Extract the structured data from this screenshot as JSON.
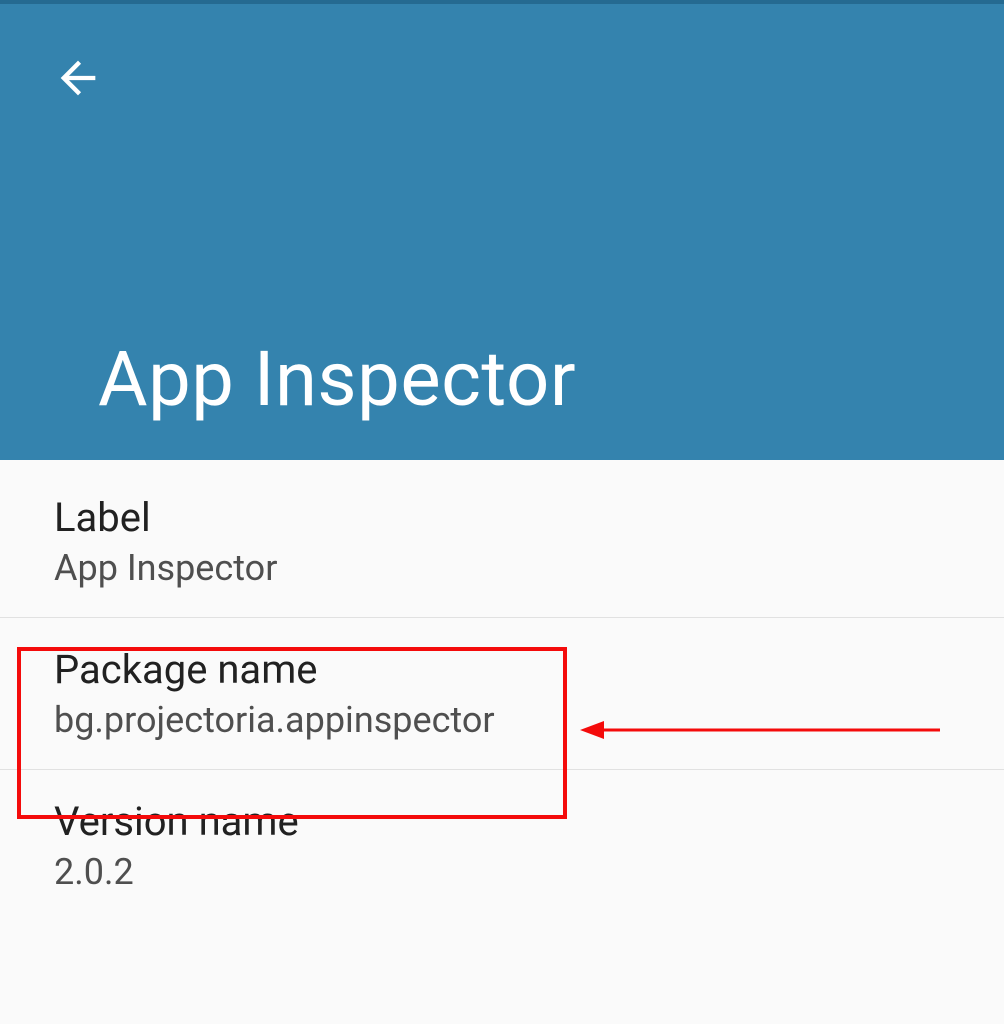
{
  "header": {
    "title": "App Inspector"
  },
  "details": [
    {
      "title": "Label",
      "value": "App Inspector"
    },
    {
      "title": "Package name",
      "value": "bg.projectoria.appinspector"
    },
    {
      "title": "Version name",
      "value": "2.0.2"
    }
  ],
  "annotation": {
    "highlight_index": 1
  }
}
